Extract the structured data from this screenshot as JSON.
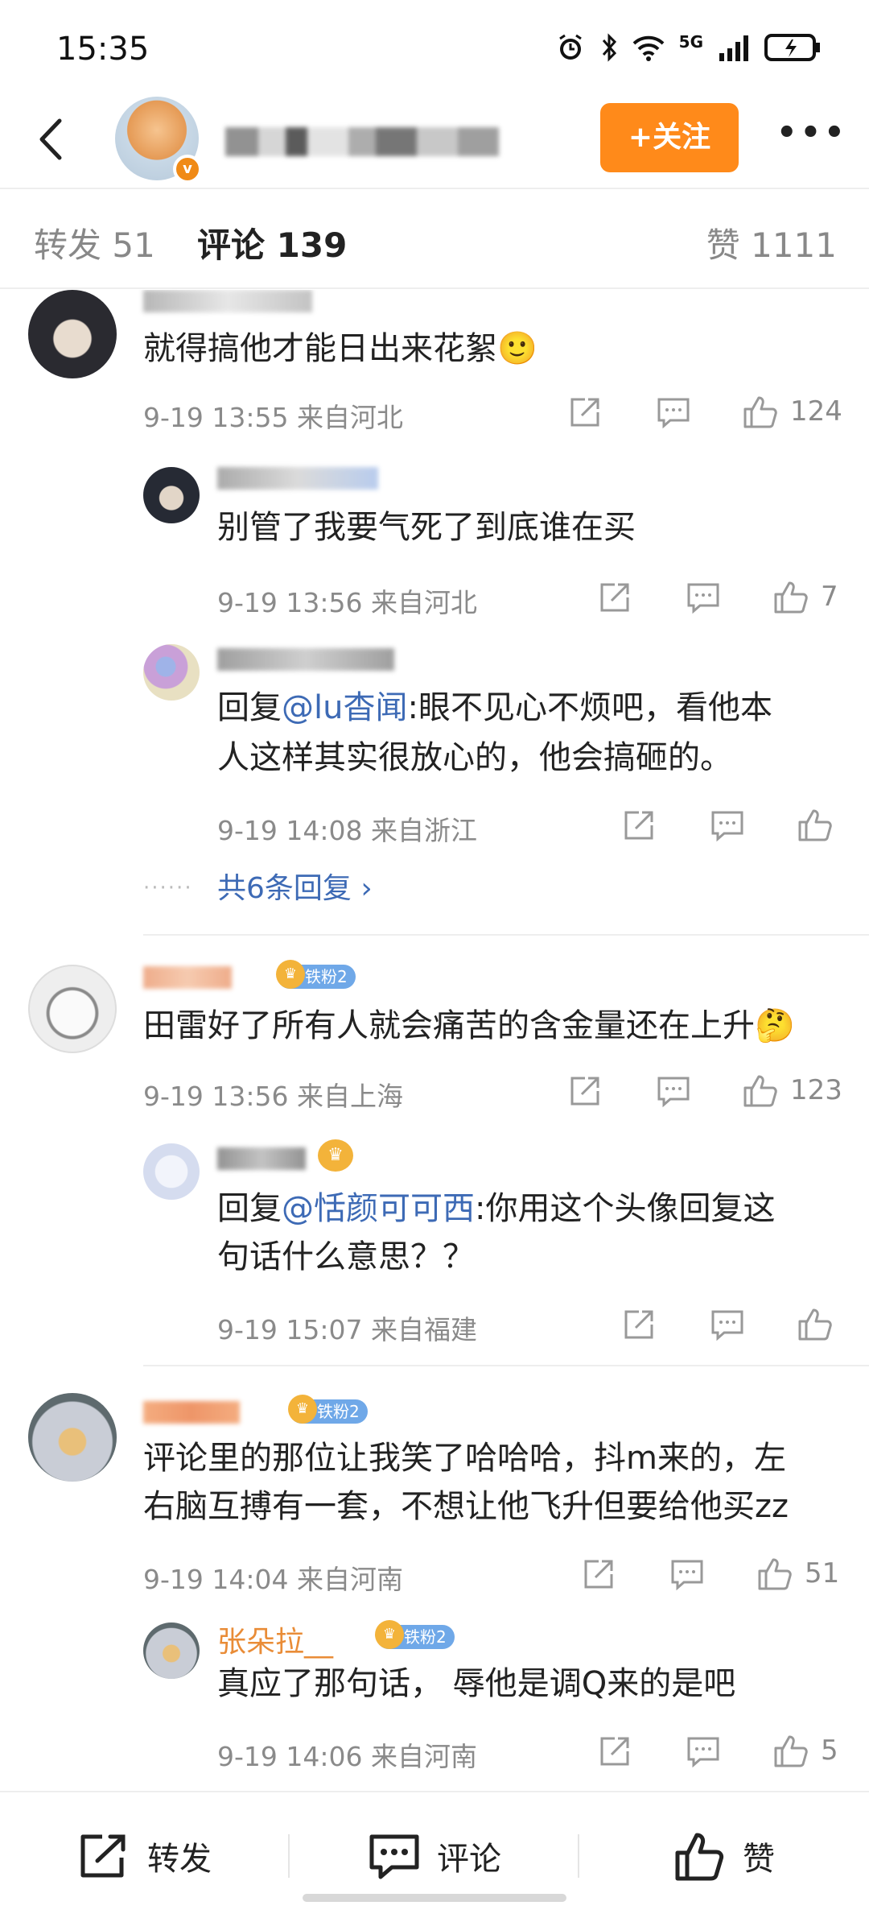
{
  "status_bar": {
    "time": "15:35",
    "network": "5G"
  },
  "header": {
    "follow_label": "+关注",
    "more_label": "•••"
  },
  "tabs": {
    "repost": "转发 51",
    "comments": "评论 139",
    "likes": "赞 1111"
  },
  "comments": [
    {
      "text": "就得搞他才能日出来花絮🙂",
      "meta": "9-19 13:55 来自河北",
      "like_count": "124",
      "replies": [
        {
          "text": "别管了我要气死了到底谁在买",
          "meta": "9-19 13:56 来自河北",
          "like_count": "7"
        },
        {
          "prefix": "回复",
          "mention": "@lu杳闻",
          "text_line1": ":眼不见心不烦吧，看他本",
          "text_line2": "人这样其实很放心的，他会搞砸的。",
          "meta": "9-19 14:08 来自浙江",
          "like_count": ""
        }
      ],
      "more_replies": "共6条回复 ›",
      "more_dots": "······"
    },
    {
      "badge": "铁粉2",
      "text": "田雷好了所有人就会痛苦的含金量还在上升🤔",
      "meta": "9-19 13:56 来自上海",
      "like_count": "123",
      "replies": [
        {
          "prefix": "回复",
          "mention": "@恬颜可可西",
          "text_line1": ":你用这个头像回复这",
          "text_line2": "句话什么意思？？",
          "meta": "9-19 15:07 来自福建",
          "like_count": ""
        }
      ]
    },
    {
      "badge": "铁粉2",
      "text_line1": "评论里的那位让我笑了哈哈哈，抖m来的，左",
      "text_line2": "右脑互搏有一套，不想让他飞升但要给他买zz",
      "meta": "9-19 14:04 来自河南",
      "like_count": "51",
      "replies": [
        {
          "name": "张朵拉__",
          "badge": "铁粉2",
          "text": "真应了那句话， 辱他是调Q来的是吧",
          "meta": "9-19 14:06 来自河南",
          "like_count": "5"
        }
      ]
    }
  ],
  "bottom_bar": {
    "repost": "转发",
    "comment": "评论",
    "like": "赞"
  },
  "icons": [
    "back-icon",
    "share-icon",
    "comment-icon",
    "thumbs-up-icon",
    "alarm-icon",
    "bluetooth-icon",
    "wifi-icon",
    "signal-icon",
    "battery-icon"
  ]
}
